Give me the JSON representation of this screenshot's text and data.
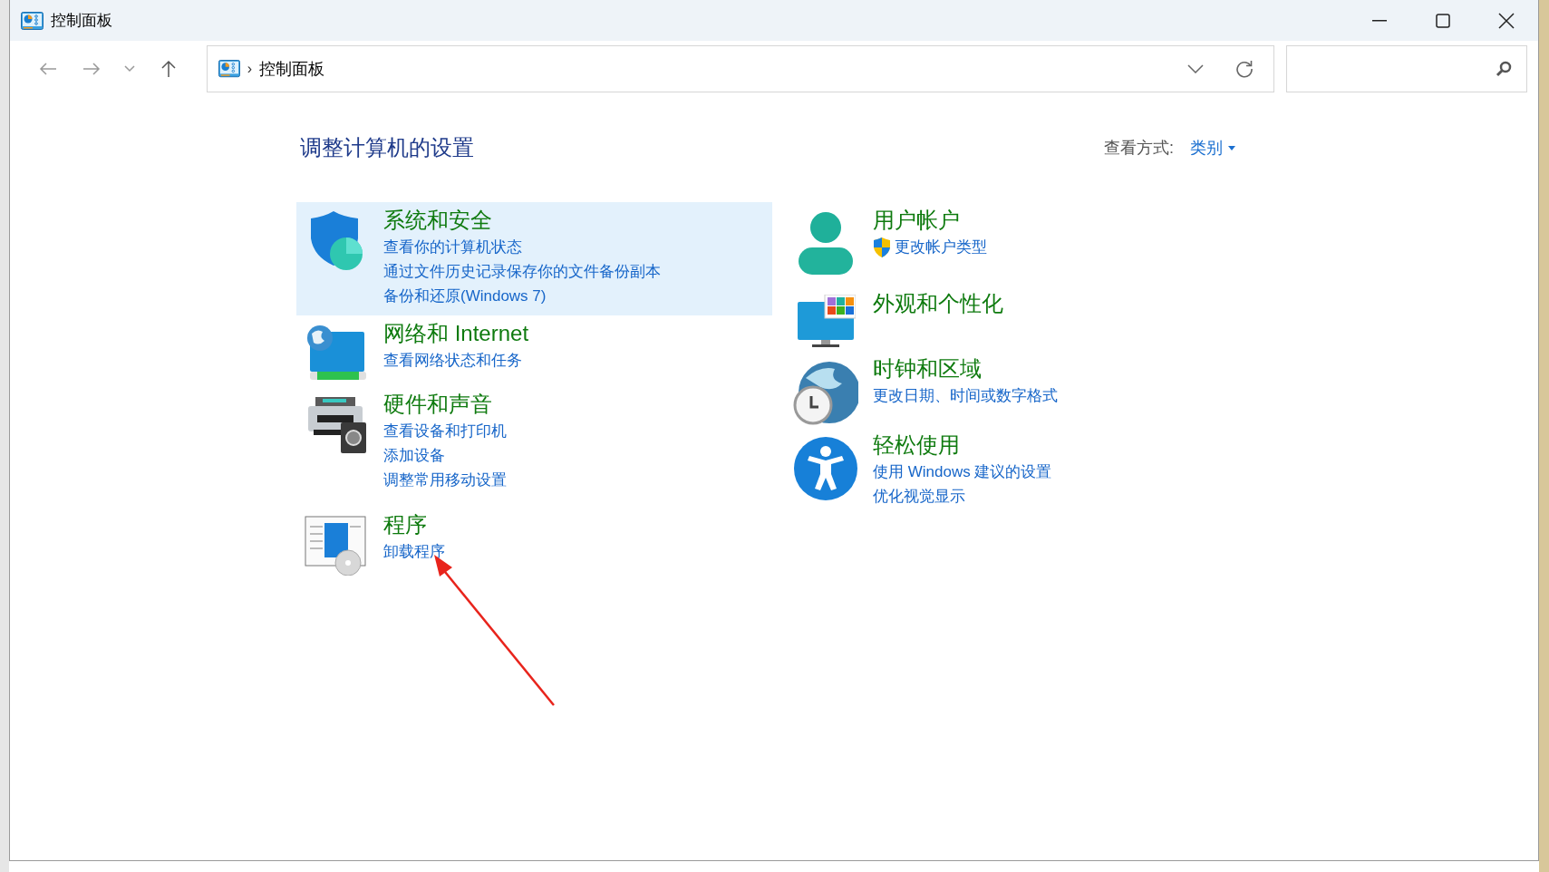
{
  "window": {
    "title": "控制面板"
  },
  "address_bar": {
    "separator": "›",
    "breadcrumb": "控制面板"
  },
  "content": {
    "heading": "调整计算机的设置",
    "view_by": {
      "label": "查看方式:",
      "value": "类别"
    }
  },
  "categories_left": [
    {
      "kind": "security",
      "title": "系统和安全",
      "selected": true,
      "links": [
        {
          "text": "查看你的计算机状态",
          "shield": false
        },
        {
          "text": "通过文件历史记录保存你的文件备份副本",
          "shield": false
        },
        {
          "text": "备份和还原(Windows 7)",
          "shield": false
        }
      ]
    },
    {
      "kind": "network",
      "title": "网络和 Internet",
      "selected": false,
      "links": [
        {
          "text": "查看网络状态和任务",
          "shield": false
        }
      ]
    },
    {
      "kind": "hardware",
      "title": "硬件和声音",
      "selected": false,
      "links": [
        {
          "text": "查看设备和打印机",
          "shield": false
        },
        {
          "text": "添加设备",
          "shield": false
        },
        {
          "text": "调整常用移动设置",
          "shield": false
        }
      ]
    },
    {
      "kind": "programs",
      "title": "程序",
      "selected": false,
      "links": [
        {
          "text": "卸载程序",
          "shield": false
        }
      ]
    }
  ],
  "categories_right": [
    {
      "kind": "user",
      "title": "用户帐户",
      "selected": false,
      "links": [
        {
          "text": "更改帐户类型",
          "shield": true
        }
      ]
    },
    {
      "kind": "appearance",
      "title": "外观和个性化",
      "selected": false
    },
    {
      "kind": "clock",
      "title": "时钟和区域",
      "selected": false,
      "links": [
        {
          "text": "更改日期、时间或数字格式",
          "shield": false
        }
      ]
    },
    {
      "kind": "ease",
      "title": "轻松使用",
      "selected": false,
      "links": [
        {
          "text": "使用 Windows 建议的设置",
          "shield": false
        },
        {
          "text": "优化视觉显示",
          "shield": false
        }
      ]
    }
  ]
}
